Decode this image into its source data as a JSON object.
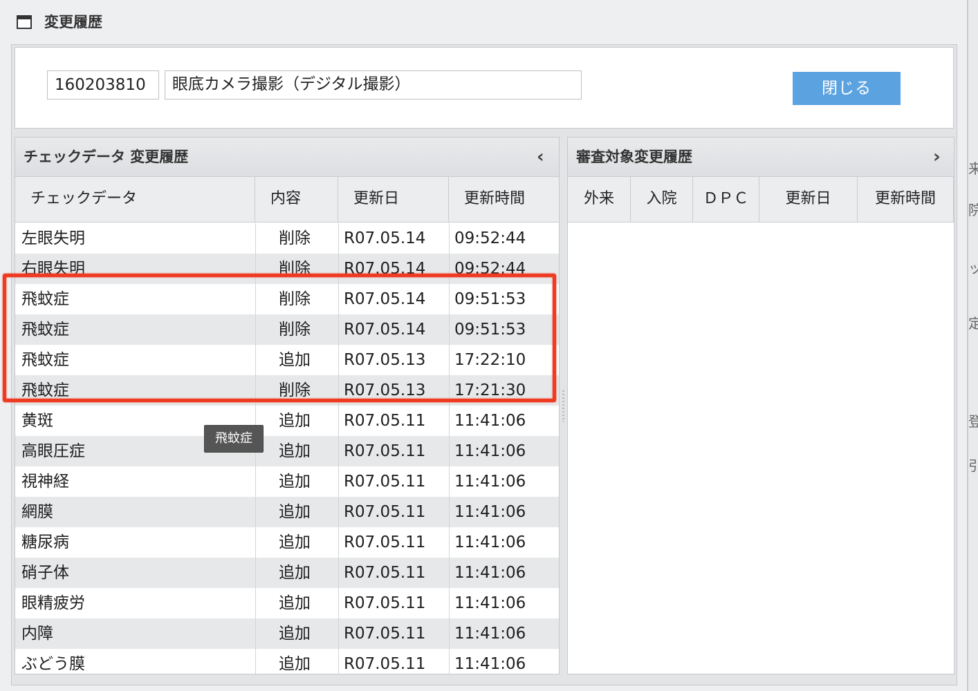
{
  "window": {
    "title": "変更履歴",
    "icon": "window-icon"
  },
  "top": {
    "code_value": "160203810",
    "name_value": "眼底カメラ撮影（デジタル撮影）",
    "close_label": "閉じる"
  },
  "left_panel": {
    "title": "チェックデータ 変更履歴",
    "collapse_icon": "chevron-left-icon",
    "columns": [
      "チェックデータ",
      "内容",
      "更新日",
      "更新時間"
    ],
    "rows": [
      {
        "name": "左眼失明",
        "kind": "削除",
        "date": "R07.05.14",
        "time": "09:52:44"
      },
      {
        "name": "右眼失明",
        "kind": "削除",
        "date": "R07.05.14",
        "time": "09:52:44"
      },
      {
        "name": "飛蚊症",
        "kind": "削除",
        "date": "R07.05.14",
        "time": "09:51:53"
      },
      {
        "name": "飛蚊症",
        "kind": "削除",
        "date": "R07.05.14",
        "time": "09:51:53"
      },
      {
        "name": "飛蚊症",
        "kind": "追加",
        "date": "R07.05.13",
        "time": "17:22:10"
      },
      {
        "name": "飛蚊症",
        "kind": "削除",
        "date": "R07.05.13",
        "time": "17:21:30"
      },
      {
        "name": "黄斑",
        "kind": "追加",
        "date": "R07.05.11",
        "time": "11:41:06"
      },
      {
        "name": "高眼圧症",
        "kind": "追加",
        "date": "R07.05.11",
        "time": "11:41:06"
      },
      {
        "name": "視神経",
        "kind": "追加",
        "date": "R07.05.11",
        "time": "11:41:06"
      },
      {
        "name": "網膜",
        "kind": "追加",
        "date": "R07.05.11",
        "time": "11:41:06"
      },
      {
        "name": "糖尿病",
        "kind": "追加",
        "date": "R07.05.11",
        "time": "11:41:06"
      },
      {
        "name": "硝子体",
        "kind": "追加",
        "date": "R07.05.11",
        "time": "11:41:06"
      },
      {
        "name": "眼精疲労",
        "kind": "追加",
        "date": "R07.05.11",
        "time": "11:41:06"
      },
      {
        "name": "内障",
        "kind": "追加",
        "date": "R07.05.11",
        "time": "11:41:06"
      },
      {
        "name": "ぶどう膜",
        "kind": "追加",
        "date": "R07.05.11",
        "time": "11:41:06"
      }
    ],
    "tooltip": "飛蚊症"
  },
  "right_panel": {
    "title": "審査対象変更履歴",
    "expand_icon": "chevron-right-icon",
    "columns": [
      "外来",
      "入院",
      "ＤＰＣ",
      "更新日",
      "更新時間"
    ]
  },
  "edge_fragments": [
    "来",
    "院",
    "ッ",
    "定",
    "登",
    "引"
  ],
  "colors": {
    "button": "#5aa2e0",
    "highlight": "#ee3b22",
    "alt_row": "#e7e8ea"
  }
}
